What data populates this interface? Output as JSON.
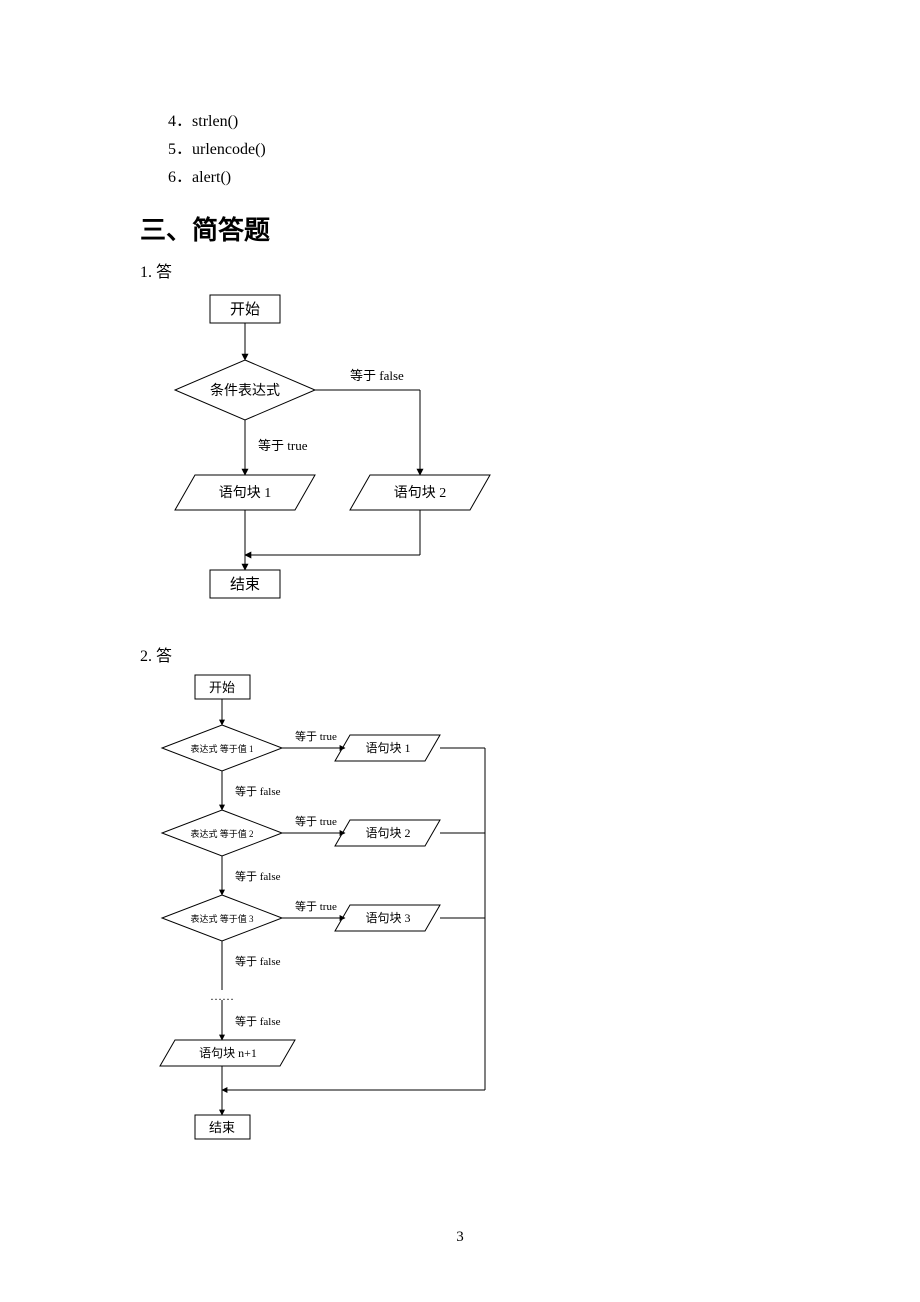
{
  "list": [
    {
      "num": "4．",
      "text": "strlen()"
    },
    {
      "num": "5．",
      "text": "urlencode()"
    },
    {
      "num": "6．",
      "text": "alert()"
    }
  ],
  "section_heading": "三、简答题",
  "q1": "1.  答",
  "q2": "2.  答",
  "page_number": "3",
  "flow1": {
    "start": "开始",
    "condition": "条件表达式",
    "label_false": "等于 false",
    "label_true": "等于 true",
    "block1": "语句块 1",
    "block2": "语句块 2",
    "end": "结束"
  },
  "flow2": {
    "start": "开始",
    "cond1": "表达式 等于值 1",
    "cond2": "表达式 等于值 2",
    "cond3": "表达式 等于值 3",
    "true": "等于 true",
    "false": "等于 false",
    "block1": "语句块 1",
    "block2": "语句块 2",
    "block3": "语句块 3",
    "ellipsis": "……",
    "block_n1": "语句块 n+1",
    "end": "结束"
  }
}
